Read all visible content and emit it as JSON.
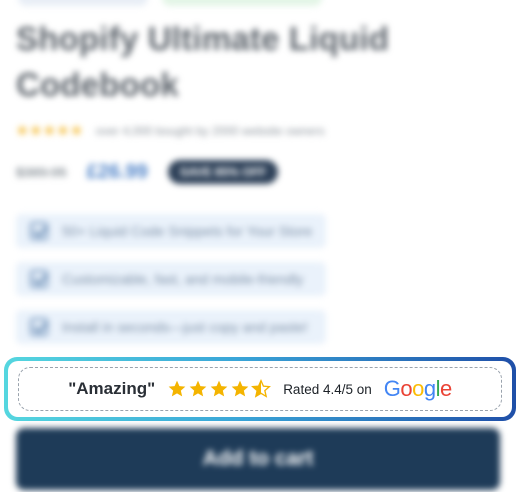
{
  "product": {
    "title": "Shopify Ultimate Liquid Codebook",
    "rating_text": "over 4,000 bought by 2000 website owners",
    "old_price": "$389.95",
    "new_price": "£26.99",
    "sale_badge": "SAVE 85% OFF",
    "features": [
      "50+ Liquid Code Snippets for Your Store",
      "Customizable, fast, and mobile-friendly",
      "Install in seconds—just copy and paste!"
    ]
  },
  "review_banner": {
    "quote": "\"Amazing\"",
    "stars": 4.5,
    "rated_text": "Rated 4.4/5 on",
    "brand": "Google",
    "colors": {
      "star": "#f4b400",
      "frame_start": "#55d6df",
      "frame_end": "#1f4fa8"
    }
  },
  "cart_button": {
    "label": "Add to cart",
    "color": "#1e3b58"
  }
}
